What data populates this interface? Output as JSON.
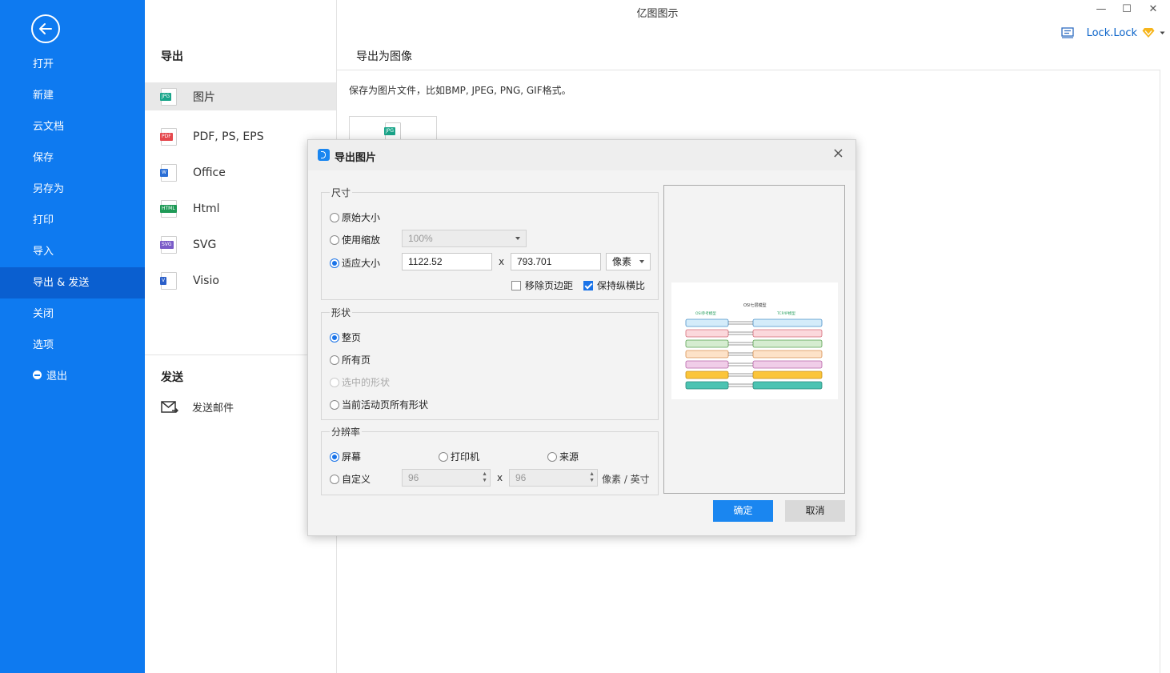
{
  "app": {
    "title": "亿图图示"
  },
  "window_controls": {
    "minimize": "—",
    "maximize": "☐",
    "close": "✕"
  },
  "user": {
    "name": "Lock.Lock"
  },
  "sidebar": {
    "items": [
      {
        "id": "open",
        "label": "打开"
      },
      {
        "id": "new",
        "label": "新建"
      },
      {
        "id": "cloud",
        "label": "云文档"
      },
      {
        "id": "save",
        "label": "保存"
      },
      {
        "id": "saveas",
        "label": "另存为"
      },
      {
        "id": "print",
        "label": "打印"
      },
      {
        "id": "import",
        "label": "导入"
      },
      {
        "id": "export",
        "label": "导出 & 发送"
      },
      {
        "id": "close",
        "label": "关闭"
      },
      {
        "id": "options",
        "label": "选项"
      },
      {
        "id": "exit",
        "label": "退出"
      }
    ],
    "active": "export"
  },
  "export_panel": {
    "heading": "导出",
    "items": [
      {
        "label": "图片",
        "badge": "JPG",
        "color": "#1aa58a"
      },
      {
        "label": "PDF, PS, EPS",
        "badge": "PDF",
        "color": "#e5484d"
      },
      {
        "label": "Office",
        "badge": "W",
        "color": "#2b6fd6"
      },
      {
        "label": "Html",
        "badge": "HTML",
        "color": "#1f9a57"
      },
      {
        "label": "SVG",
        "badge": "SVG",
        "color": "#7a5cc8"
      },
      {
        "label": "Visio",
        "badge": "V",
        "color": "#2b5fc9"
      }
    ],
    "send_heading": "发送",
    "send_item": "发送邮件"
  },
  "content": {
    "heading": "导出为图像",
    "description": "保存为图片文件，比如BMP, JPEG, PNG, GIF格式。",
    "thumb_badge": "JPG"
  },
  "dialog": {
    "title": "导出图片",
    "close_icon": "×",
    "size_group": {
      "label": "尺寸",
      "original": "原始大小",
      "zoom": "使用缩放",
      "zoom_value": "100%",
      "fit": "适应大小",
      "width": "1122.52",
      "times": "x",
      "height": "793.701",
      "unit": "像素",
      "remove_margin": "移除页边距",
      "keep_ratio": "保持纵横比"
    },
    "shape_group": {
      "label": "形状",
      "whole_page": "整页",
      "all_pages": "所有页",
      "selected_shapes": "选中的形状",
      "all_shapes_active": "当前活动页所有形状"
    },
    "resolution_group": {
      "label": "分辨率",
      "screen": "屏幕",
      "printer": "打印机",
      "source": "来源",
      "custom": "自定义",
      "dpi_x": "96",
      "times": "x",
      "dpi_y": "96",
      "unit": "像素 / 英寸"
    },
    "ok": "确定",
    "cancel": "取消"
  },
  "preview": {
    "title": "OSI七层模型",
    "left_header": "OSI参考模型",
    "right_header": "TCP/IP模型",
    "rows": [
      {
        "fill": "#d4ecfa",
        "stroke": "#4a90c8"
      },
      {
        "fill": "#fbd8dc",
        "stroke": "#d46b78"
      },
      {
        "fill": "#d5ecd0",
        "stroke": "#5aa050"
      },
      {
        "fill": "#fde2c8",
        "stroke": "#d89050"
      },
      {
        "fill": "#f0cde8",
        "stroke": "#b864a8"
      },
      {
        "fill": "#fbc53a",
        "stroke": "#c8901a"
      },
      {
        "fill": "#4cc3b2",
        "stroke": "#2a8a7c"
      }
    ]
  }
}
